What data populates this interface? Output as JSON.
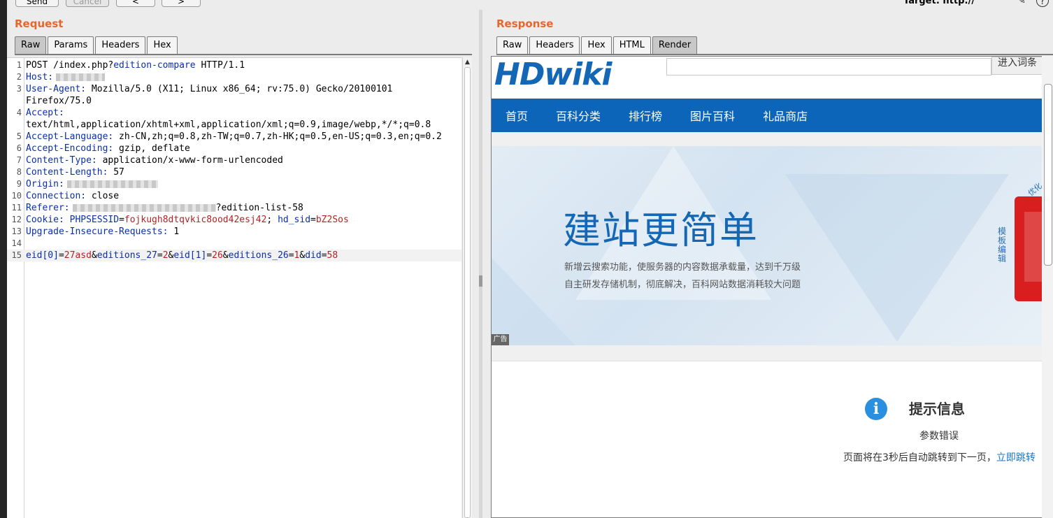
{
  "toolbar": {
    "send_label": "Send",
    "cancel_label": "Cancel",
    "back_label": "<",
    "forward_label": ">",
    "target_label": "Target: http://",
    "edit_icon": "pencil-icon",
    "help_icon": "help-icon"
  },
  "request": {
    "title": "Request",
    "tabs": [
      "Raw",
      "Params",
      "Headers",
      "Hex"
    ],
    "active_tab": "Raw",
    "lines": [
      {
        "n": "1",
        "parts": [
          {
            "t": "POST /index.php?",
            "c": "v"
          },
          {
            "t": "edition-compare",
            "c": "k"
          },
          {
            "t": " HTTP/1.1",
            "c": "v"
          }
        ]
      },
      {
        "n": "2",
        "parts": [
          {
            "t": "Host:",
            "c": "k"
          }
        ],
        "blur": 70
      },
      {
        "n": "3",
        "parts": [
          {
            "t": "User-Agent:",
            "c": "k"
          },
          {
            "t": " Mozilla/5.0 (X11; Linux x86_64; rv:75.0) Gecko/20100101",
            "c": "v"
          }
        ]
      },
      {
        "n": "",
        "parts": [
          {
            "t": "Firefox/75.0",
            "c": "v"
          }
        ]
      },
      {
        "n": "4",
        "parts": [
          {
            "t": "Accept:",
            "c": "k"
          }
        ]
      },
      {
        "n": "",
        "parts": [
          {
            "t": "text/html,application/xhtml+xml,application/xml;q=0.9,image/webp,*/*;q=0.8",
            "c": "v"
          }
        ]
      },
      {
        "n": "5",
        "parts": [
          {
            "t": "Accept-Language:",
            "c": "k"
          },
          {
            "t": " zh-CN,zh;q=0.8,zh-TW;q=0.7,zh-HK;q=0.5,en-US;q=0.3,en;q=0.2",
            "c": "v"
          }
        ]
      },
      {
        "n": "6",
        "parts": [
          {
            "t": "Accept-Encoding:",
            "c": "k"
          },
          {
            "t": " gzip, deflate",
            "c": "v"
          }
        ]
      },
      {
        "n": "7",
        "parts": [
          {
            "t": "Content-Type:",
            "c": "k"
          },
          {
            "t": " application/x-www-form-urlencoded",
            "c": "v"
          }
        ]
      },
      {
        "n": "8",
        "parts": [
          {
            "t": "Content-Length:",
            "c": "k"
          },
          {
            "t": " 57",
            "c": "v"
          }
        ]
      },
      {
        "n": "9",
        "parts": [
          {
            "t": "Origin:",
            "c": "k"
          }
        ],
        "blur": 130
      },
      {
        "n": "10",
        "parts": [
          {
            "t": "Connection:",
            "c": "k"
          },
          {
            "t": " close",
            "c": "v"
          }
        ]
      },
      {
        "n": "11",
        "parts": [
          {
            "t": "Referer:",
            "c": "k"
          }
        ],
        "blur": 205,
        "after": [
          {
            "t": "?edition-list-58",
            "c": "v"
          }
        ]
      },
      {
        "n": "12",
        "parts": [
          {
            "t": "Cookie:",
            "c": "k"
          },
          {
            "t": " PHPSESSID",
            "c": "k"
          },
          {
            "t": "=",
            "c": "v"
          },
          {
            "t": "fojkugh8dtqvkic8ood42esj42",
            "c": "c"
          },
          {
            "t": "; ",
            "c": "v"
          },
          {
            "t": "hd_sid",
            "c": "k"
          },
          {
            "t": "=",
            "c": "v"
          },
          {
            "t": "bZ2Sos",
            "c": "c"
          }
        ]
      },
      {
        "n": "13",
        "parts": [
          {
            "t": "Upgrade-Insecure-Requests:",
            "c": "k"
          },
          {
            "t": " 1",
            "c": "v"
          }
        ]
      },
      {
        "n": "14",
        "parts": []
      },
      {
        "n": "15",
        "active": true,
        "parts": [
          {
            "t": "eid[0]",
            "c": "k"
          },
          {
            "t": "=",
            "c": "v"
          },
          {
            "t": "27asd",
            "c": "c"
          },
          {
            "t": "&",
            "c": "v"
          },
          {
            "t": "editions_27",
            "c": "k"
          },
          {
            "t": "=",
            "c": "v"
          },
          {
            "t": "2",
            "c": "c"
          },
          {
            "t": "&",
            "c": "v"
          },
          {
            "t": "eid[1]",
            "c": "k"
          },
          {
            "t": "=",
            "c": "v"
          },
          {
            "t": "26",
            "c": "c"
          },
          {
            "t": "&",
            "c": "v"
          },
          {
            "t": "editions_26",
            "c": "k"
          },
          {
            "t": "=",
            "c": "v"
          },
          {
            "t": "1",
            "c": "c"
          },
          {
            "t": "&",
            "c": "v"
          },
          {
            "t": "did",
            "c": "k"
          },
          {
            "t": "=",
            "c": "v"
          },
          {
            "t": "58",
            "c": "c"
          }
        ]
      }
    ]
  },
  "response": {
    "title": "Response",
    "tabs": [
      "Raw",
      "Headers",
      "Hex",
      "HTML",
      "Render"
    ],
    "active_tab": "Render",
    "page": {
      "logo": "HDwiki",
      "search_button": "进入词条",
      "nav": [
        "首页",
        "百科分类",
        "排行榜",
        "图片百科",
        "礼品商店"
      ],
      "banner_title": "建站更简单",
      "banner_line1": "新增云搜索功能，使服务器的内容数据承载量，达到千万级",
      "banner_line2": "自主研发存储机制，彻底解决，百科网站数据消耗较大问题",
      "side_text": "模板编辑",
      "side_text2": "优化",
      "ad_label": "广告",
      "info_title": "提示信息",
      "info_message": "参数错误",
      "redirect_text": "页面将在3秒后自动跳转到下一页，",
      "redirect_link": "立即跳转"
    }
  }
}
